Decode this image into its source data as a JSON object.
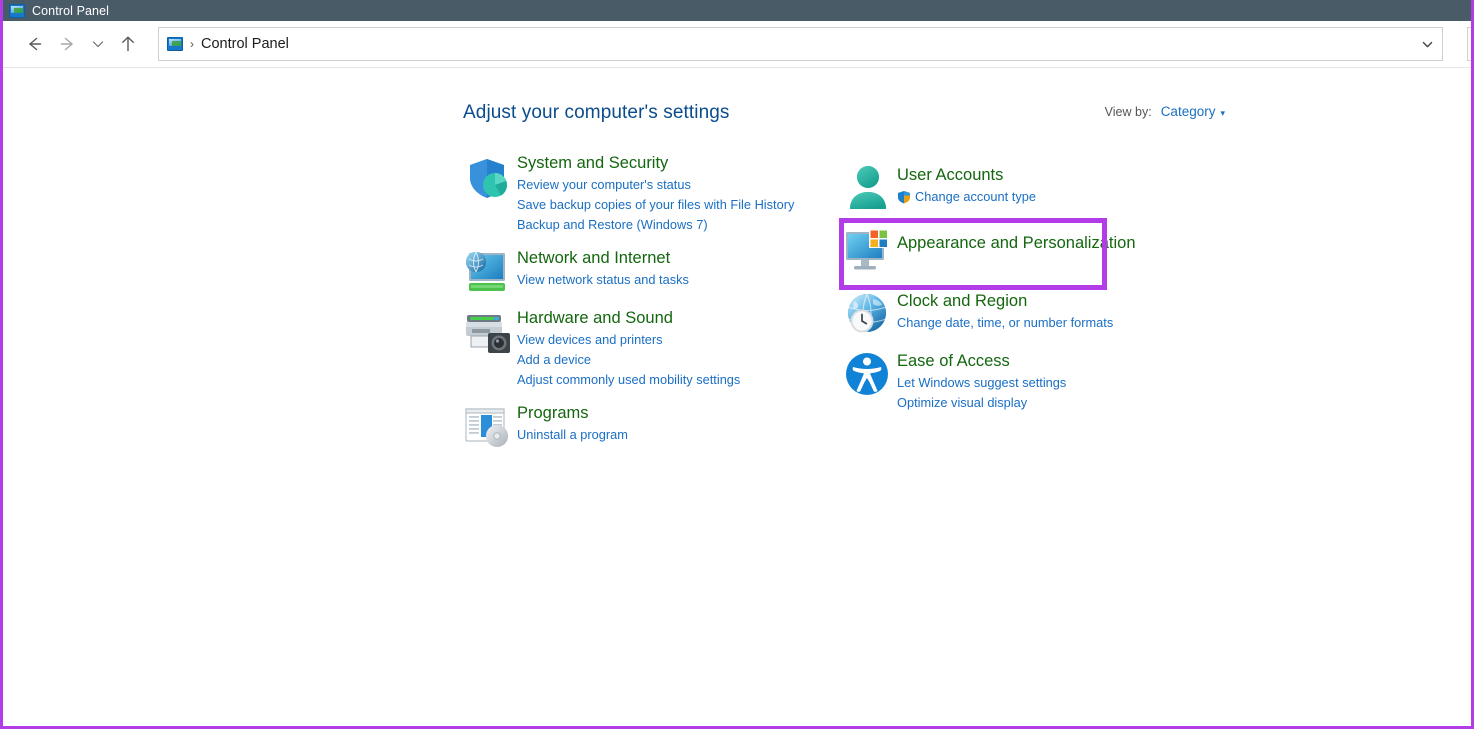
{
  "window": {
    "title": "Control Panel",
    "title_icon": "control-panel-icon"
  },
  "navbar": {
    "back_icon": "back-arrow-icon",
    "forward_icon": "forward-arrow-icon",
    "recent_icon": "recent-locations-chevron-icon",
    "up_icon": "up-arrow-icon",
    "address": {
      "icon": "control-panel-icon",
      "separator": "›",
      "crumb": "Control Panel",
      "dropdown_icon": "chevron-down-icon"
    }
  },
  "main": {
    "heading": "Adjust your computer's settings",
    "view_by": {
      "label": "View by:",
      "value": "Category",
      "caret": "▾"
    }
  },
  "categories": {
    "left": [
      {
        "icon": "shield-security-icon",
        "title": "System and Security",
        "links": [
          {
            "text": "Review your computer's status",
            "uac": false
          },
          {
            "text": "Save backup copies of your files with File History",
            "uac": false
          },
          {
            "text": "Backup and Restore (Windows 7)",
            "uac": false
          }
        ]
      },
      {
        "icon": "network-globe-monitor-icon",
        "title": "Network and Internet",
        "links": [
          {
            "text": "View network status and tasks",
            "uac": false
          }
        ]
      },
      {
        "icon": "printer-camera-icon",
        "title": "Hardware and Sound",
        "links": [
          {
            "text": "View devices and printers",
            "uac": false
          },
          {
            "text": "Add a device",
            "uac": false
          },
          {
            "text": "Adjust commonly used mobility settings",
            "uac": false
          }
        ]
      },
      {
        "icon": "programs-disc-icon",
        "title": "Programs",
        "links": [
          {
            "text": "Uninstall a program",
            "uac": false
          }
        ]
      }
    ],
    "right": [
      {
        "icon": "user-accounts-person-icon",
        "title": "User Accounts",
        "highlighted": true,
        "links": [
          {
            "text": "Change account type",
            "uac": true
          }
        ]
      },
      {
        "icon": "appearance-monitor-icon",
        "title": "Appearance and Personalization",
        "links": []
      },
      {
        "icon": "clock-globe-icon",
        "title": "Clock and Region",
        "links": [
          {
            "text": "Change date, time, or number formats",
            "uac": false
          }
        ]
      },
      {
        "icon": "ease-of-access-icon",
        "title": "Ease of Access",
        "links": [
          {
            "text": "Let Windows suggest settings",
            "uac": false
          },
          {
            "text": "Optimize visual display",
            "uac": false
          }
        ]
      }
    ]
  },
  "colors": {
    "titlebar_bg": "#4a5b68",
    "heading_blue": "#0a4c8c",
    "category_green": "#14660f",
    "link_blue": "#1a6fc4",
    "highlight_purple": "#b23ce8"
  }
}
